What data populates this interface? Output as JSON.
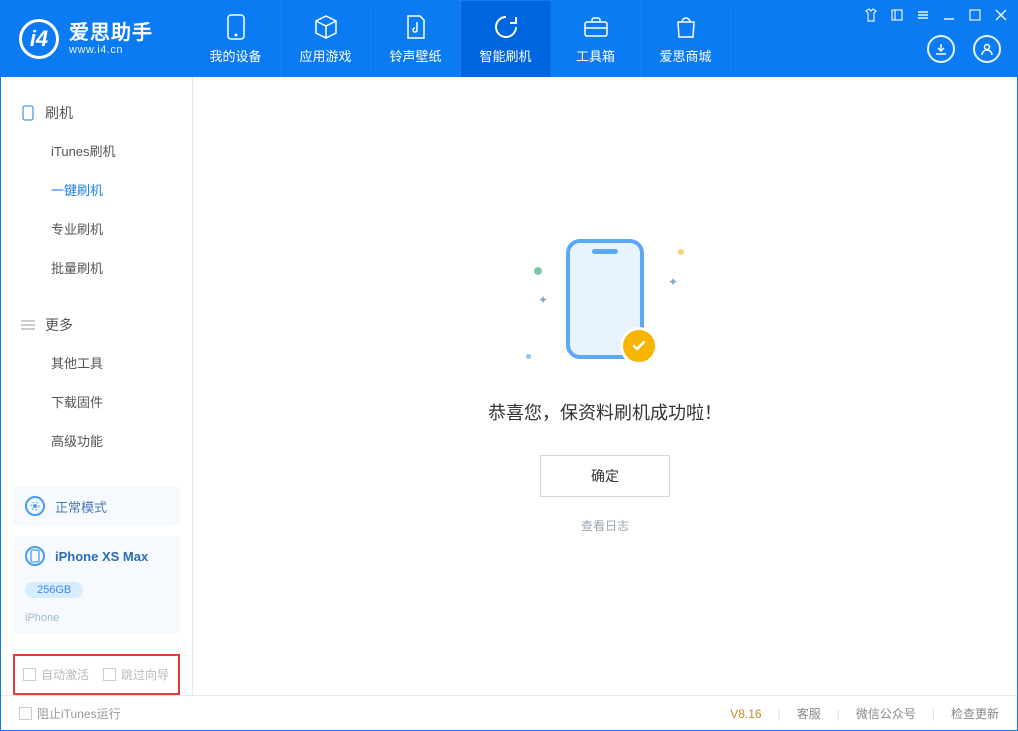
{
  "app": {
    "title": "爱思助手",
    "subtitle": "www.i4.cn"
  },
  "nav": {
    "items": [
      {
        "label": "我的设备"
      },
      {
        "label": "应用游戏"
      },
      {
        "label": "铃声壁纸"
      },
      {
        "label": "智能刷机"
      },
      {
        "label": "工具箱"
      },
      {
        "label": "爱思商城"
      }
    ]
  },
  "sidebar": {
    "group1_title": "刷机",
    "group1_items": [
      {
        "label": "iTunes刷机"
      },
      {
        "label": "一键刷机"
      },
      {
        "label": "专业刷机"
      },
      {
        "label": "批量刷机"
      }
    ],
    "group2_title": "更多",
    "group2_items": [
      {
        "label": "其他工具"
      },
      {
        "label": "下载固件"
      },
      {
        "label": "高级功能"
      }
    ]
  },
  "device": {
    "mode": "正常模式",
    "name": "iPhone XS Max",
    "storage": "256GB",
    "type": "iPhone"
  },
  "options": {
    "auto_activate": "自动激活",
    "skip_guide": "跳过向导"
  },
  "main": {
    "success_title": "恭喜您，保资料刷机成功啦！",
    "ok_button": "确定",
    "view_log": "查看日志"
  },
  "footer": {
    "block_itunes": "阻止iTunes运行",
    "version": "V8.16",
    "link_support": "客服",
    "link_wechat": "微信公众号",
    "link_update": "检查更新"
  }
}
